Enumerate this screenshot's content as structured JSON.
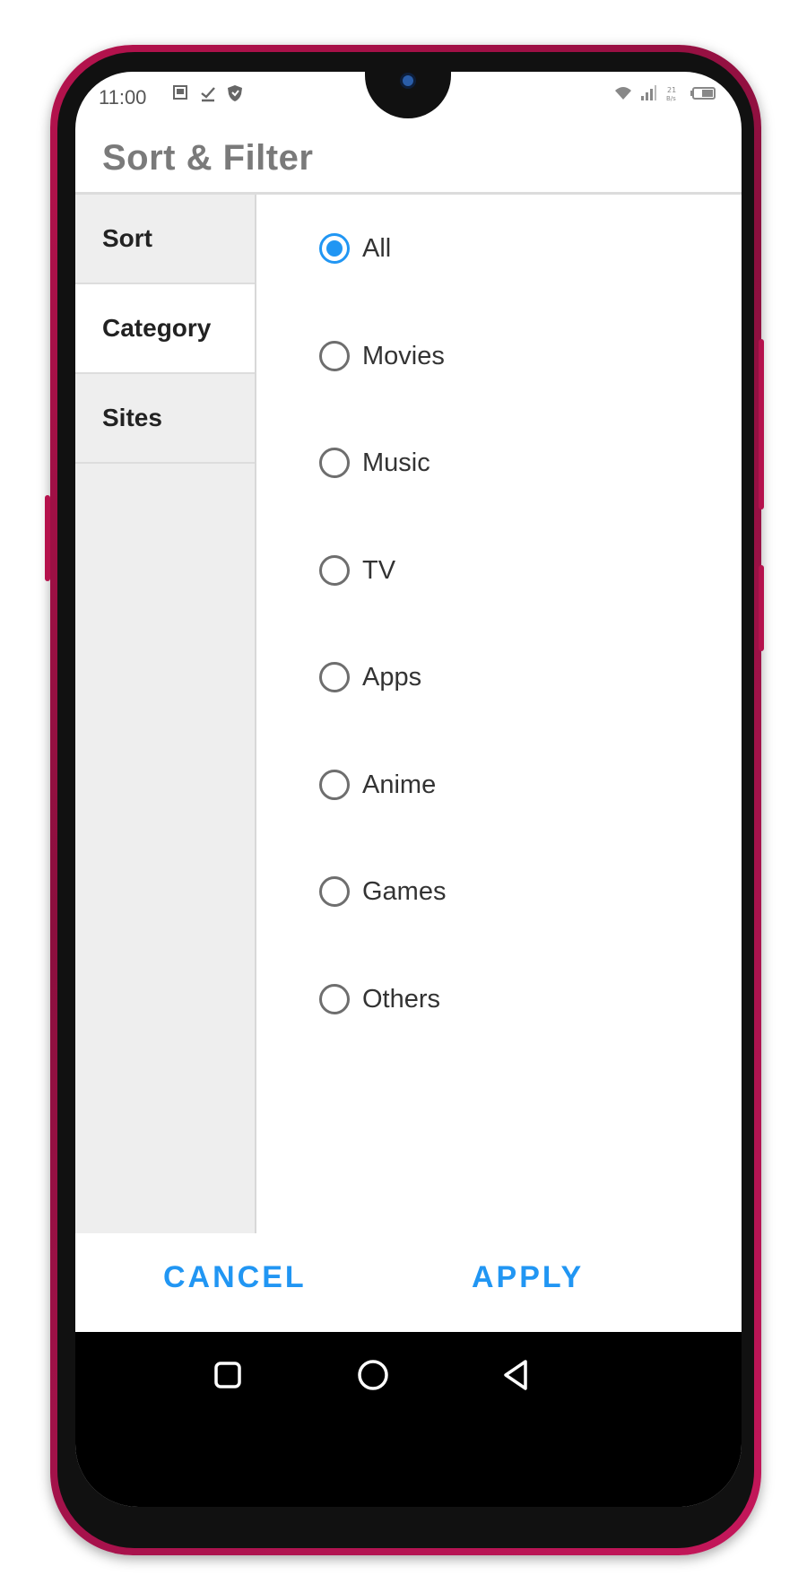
{
  "status_bar": {
    "time": "11:00",
    "left_icons": [
      "gallery-icon",
      "download-done-icon",
      "shield-icon"
    ],
    "right_icons": [
      "wifi-icon",
      "signal-icon",
      "data-speed-icon",
      "battery-icon"
    ],
    "speed_text": "21\nB/s"
  },
  "dialog": {
    "title": "Sort & Filter",
    "tabs": [
      {
        "label": "Sort",
        "active": false
      },
      {
        "label": "Category",
        "active": true
      },
      {
        "label": "Sites",
        "active": false
      }
    ],
    "options": [
      {
        "label": "All",
        "selected": true
      },
      {
        "label": "Movies",
        "selected": false
      },
      {
        "label": "Music",
        "selected": false
      },
      {
        "label": "TV",
        "selected": false
      },
      {
        "label": "Apps",
        "selected": false
      },
      {
        "label": "Anime",
        "selected": false
      },
      {
        "label": "Games",
        "selected": false
      },
      {
        "label": "Others",
        "selected": false
      }
    ],
    "cancel_label": "CANCEL",
    "apply_label": "APPLY"
  },
  "nav": {
    "recent": "recent-apps-icon",
    "home": "home-icon",
    "back": "back-icon"
  },
  "colors": {
    "accent": "#2196f3",
    "phone_frame": "#b5124d",
    "left_pane_bg": "#eeeeee"
  }
}
